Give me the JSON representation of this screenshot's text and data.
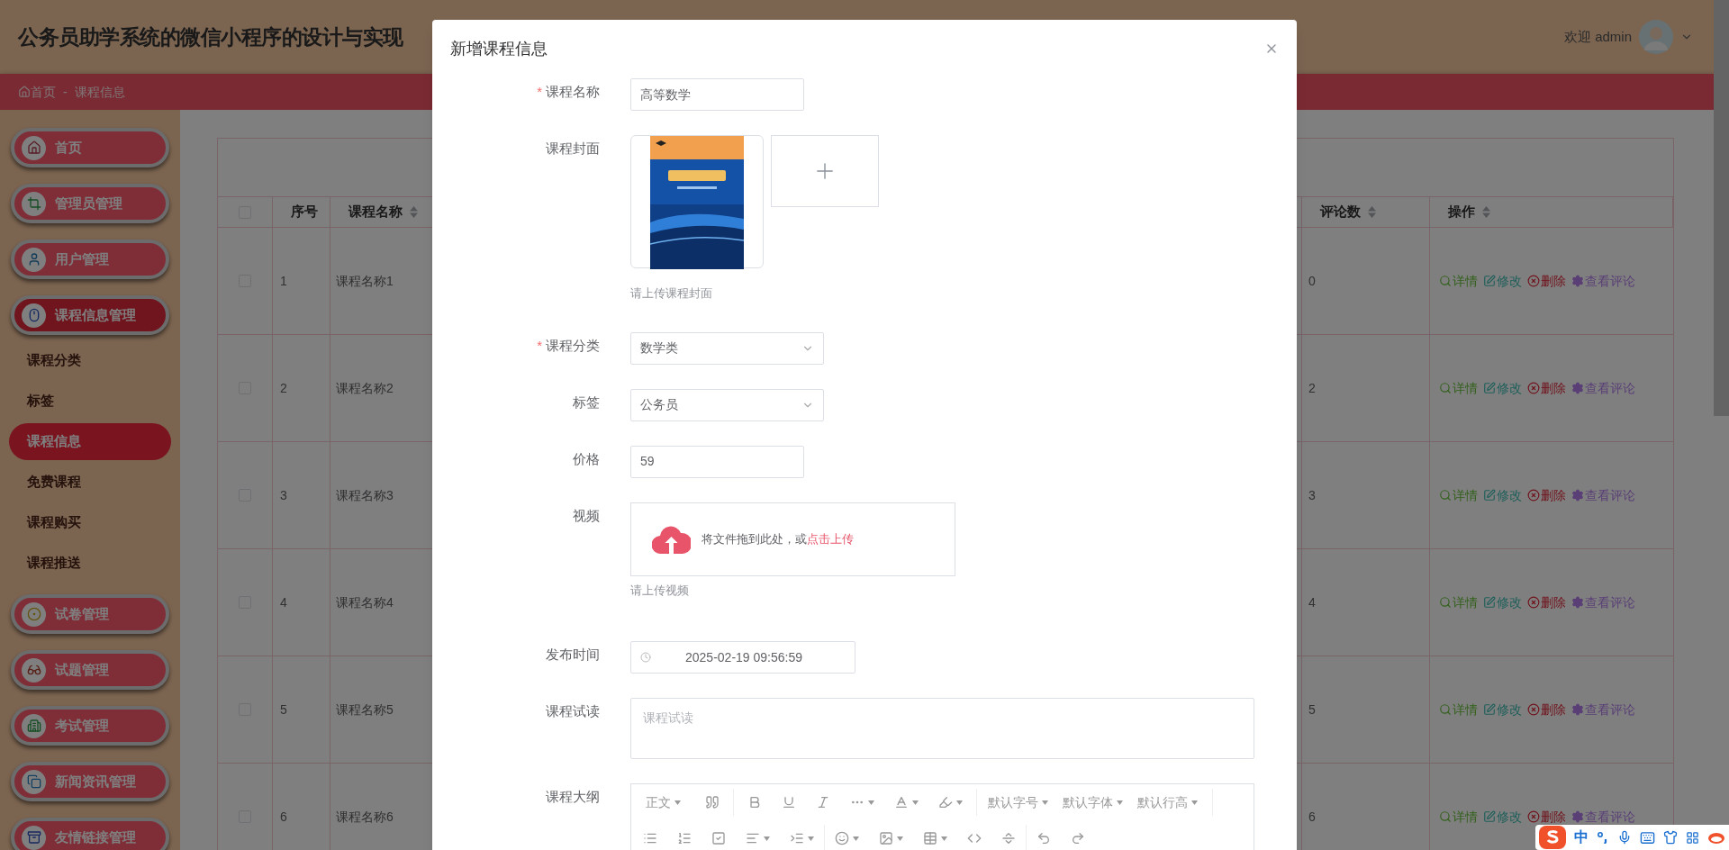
{
  "header": {
    "title": "公务员助学系统的微信小程序的设计与实现",
    "welcome": "欢迎 admin"
  },
  "breadcrumb": {
    "items": [
      "首页",
      "课程信息"
    ],
    "separator": "-"
  },
  "sidebar": {
    "items": [
      {
        "label": "首页",
        "selected": false
      },
      {
        "label": "管理员管理",
        "selected": false
      },
      {
        "label": "用户管理",
        "selected": false
      },
      {
        "label": "课程信息管理",
        "selected": true,
        "children": [
          {
            "label": "课程分类",
            "selected": false
          },
          {
            "label": "标签",
            "selected": false
          },
          {
            "label": "课程信息",
            "selected": true
          },
          {
            "label": "免费课程",
            "selected": false
          },
          {
            "label": "课程购买",
            "selected": false
          },
          {
            "label": "课程推送",
            "selected": false
          }
        ]
      },
      {
        "label": "试卷管理",
        "selected": false
      },
      {
        "label": "试题管理",
        "selected": false
      },
      {
        "label": "考试管理",
        "selected": false
      },
      {
        "label": "新闻资讯管理",
        "selected": false
      },
      {
        "label": "友情链接管理",
        "selected": false
      }
    ]
  },
  "table": {
    "all_checked": false,
    "columns": [
      {
        "label": "序号",
        "sortable": false
      },
      {
        "label": "课程名称",
        "sortable": true
      },
      {
        "label": "评论数",
        "sortable": true
      },
      {
        "label": "操作",
        "sortable": true
      }
    ],
    "rows": [
      {
        "checked": false,
        "index": "1",
        "name": "课程名称1",
        "comments": "0",
        "actions": [
          {
            "kind": "detail",
            "label": "详情"
          },
          {
            "kind": "edit",
            "label": "修改"
          },
          {
            "kind": "delete",
            "label": "删除"
          },
          {
            "kind": "comments",
            "label": "查看评论"
          }
        ]
      },
      {
        "checked": false,
        "index": "2",
        "name": "课程名称2",
        "comments": "2",
        "actions": [
          {
            "kind": "detail",
            "label": "详情"
          },
          {
            "kind": "edit",
            "label": "修改"
          },
          {
            "kind": "delete",
            "label": "删除"
          },
          {
            "kind": "comments",
            "label": "查看评论"
          }
        ]
      },
      {
        "checked": false,
        "index": "3",
        "name": "课程名称3",
        "comments": "3",
        "actions": [
          {
            "kind": "detail",
            "label": "详情"
          },
          {
            "kind": "edit",
            "label": "修改"
          },
          {
            "kind": "delete",
            "label": "删除"
          },
          {
            "kind": "comments",
            "label": "查看评论"
          }
        ]
      },
      {
        "checked": false,
        "index": "4",
        "name": "课程名称4",
        "comments": "4",
        "actions": [
          {
            "kind": "detail",
            "label": "详情"
          },
          {
            "kind": "edit",
            "label": "修改"
          },
          {
            "kind": "delete",
            "label": "删除"
          },
          {
            "kind": "comments",
            "label": "查看评论"
          }
        ]
      },
      {
        "checked": false,
        "index": "5",
        "name": "课程名称5",
        "comments": "5",
        "actions": [
          {
            "kind": "detail",
            "label": "详情"
          },
          {
            "kind": "edit",
            "label": "修改"
          },
          {
            "kind": "delete",
            "label": "删除"
          },
          {
            "kind": "comments",
            "label": "查看评论"
          }
        ]
      },
      {
        "checked": false,
        "index": "6",
        "name": "课程名称6",
        "comments": "6",
        "actions": [
          {
            "kind": "detail",
            "label": "详情"
          },
          {
            "kind": "edit",
            "label": "修改"
          },
          {
            "kind": "delete",
            "label": "删除"
          },
          {
            "kind": "comments",
            "label": "查看评论"
          }
        ]
      }
    ]
  },
  "dialog": {
    "title": "新增课程信息",
    "fields": [
      {
        "kind": "input",
        "label": "课程名称",
        "required_mark": "*",
        "value": "高等数学"
      },
      {
        "kind": "image-upload",
        "label": "课程封面",
        "hint": "请上传课程封面"
      },
      {
        "kind": "select",
        "label": "课程分类",
        "required_mark": "*",
        "value": "数学类"
      },
      {
        "kind": "select",
        "label": "标签",
        "value": "公务员"
      },
      {
        "kind": "input",
        "label": "价格",
        "value": "59"
      },
      {
        "kind": "file-upload",
        "label": "视频",
        "prompt": "将文件拖到此处，或",
        "link": "点击上传",
        "hint": "请上传视频"
      },
      {
        "kind": "datetime",
        "label": "发布时间",
        "value": "2025-02-19 09:56:59"
      },
      {
        "kind": "textarea",
        "label": "课程试读",
        "placeholder": "课程试读"
      },
      {
        "kind": "editor",
        "label": "课程大纲",
        "dropdowns": [
          "正文",
          "默认字号",
          "默认字体",
          "默认行高"
        ]
      }
    ]
  },
  "ime": {
    "mode": "中"
  }
}
